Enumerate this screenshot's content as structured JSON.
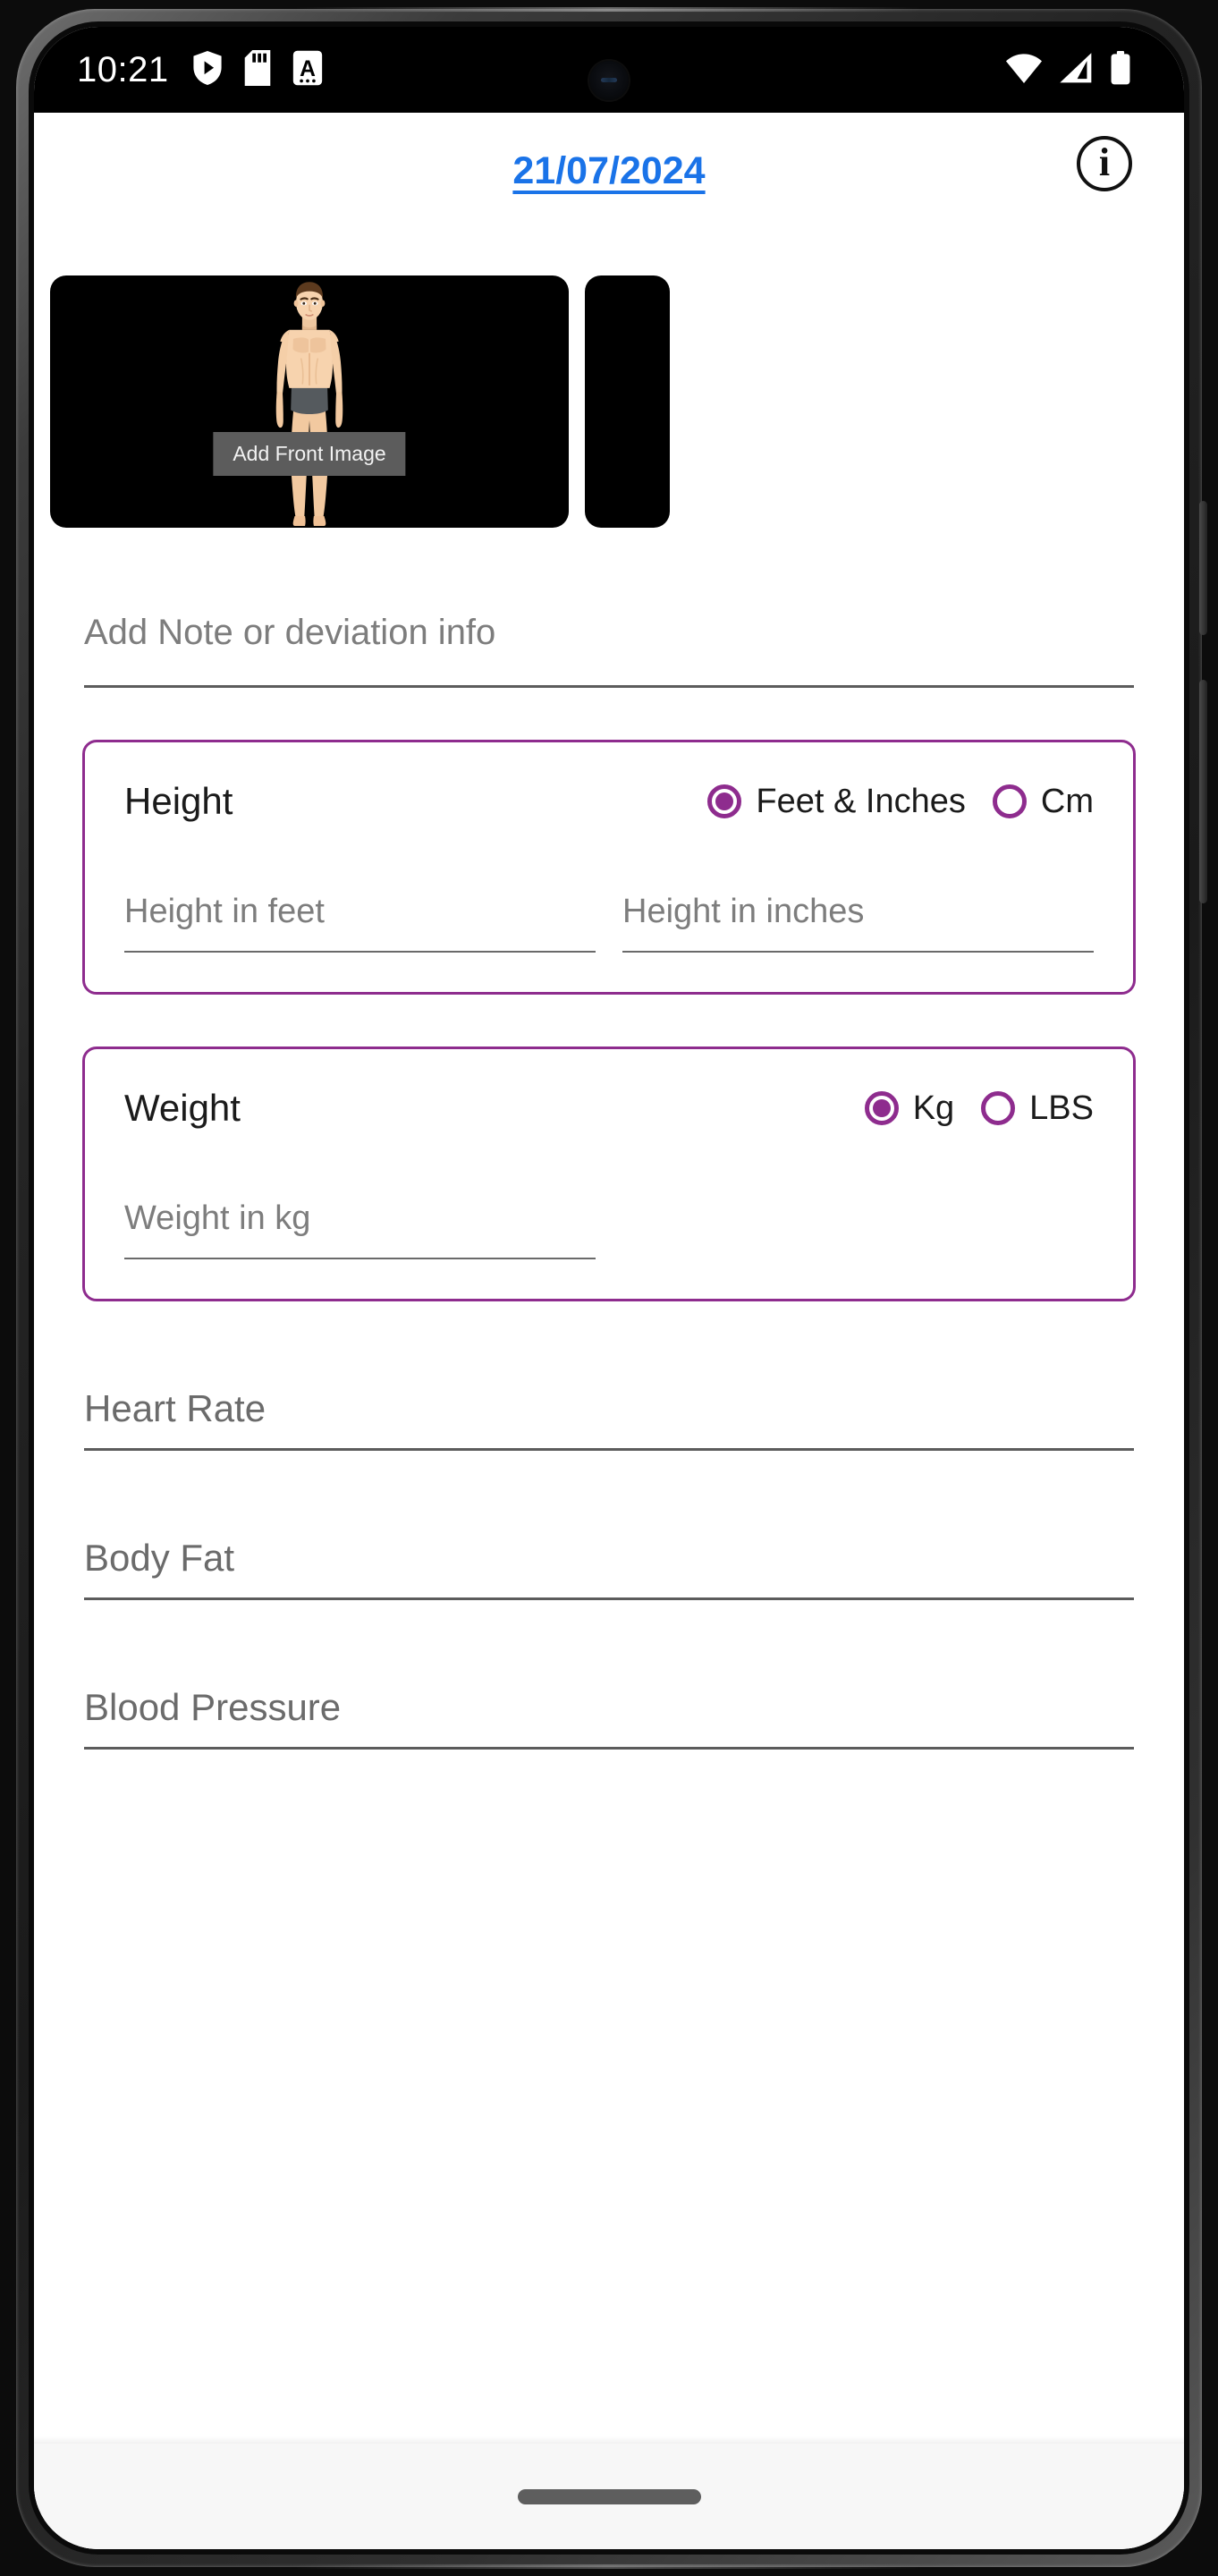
{
  "status_bar": {
    "time": "10:21",
    "left_icons": [
      "shield-play-icon",
      "sd-card-icon",
      "a-badge-icon"
    ],
    "right_icons": [
      "wifi-icon",
      "cellular-signal-icon",
      "battery-full-icon"
    ]
  },
  "header": {
    "date": "21/07/2024",
    "info_glyph": "i"
  },
  "carousel": {
    "cards": [
      {
        "label": "Add Front Image",
        "has_figure": true
      },
      {
        "label": "",
        "has_figure": false
      }
    ]
  },
  "note": {
    "placeholder": "Add Note or deviation info",
    "value": ""
  },
  "height_card": {
    "title": "Height",
    "units": [
      {
        "label": "Feet & Inches",
        "selected": true
      },
      {
        "label": "Cm",
        "selected": false
      }
    ],
    "inputs": [
      {
        "placeholder": "Height in feet",
        "value": ""
      },
      {
        "placeholder": "Height in inches",
        "value": ""
      }
    ]
  },
  "weight_card": {
    "title": "Weight",
    "units": [
      {
        "label": "Kg",
        "selected": true
      },
      {
        "label": "LBS",
        "selected": false
      }
    ],
    "inputs": [
      {
        "placeholder": "Weight in kg",
        "value": ""
      }
    ]
  },
  "vitals": [
    {
      "placeholder": "Heart Rate",
      "value": ""
    },
    {
      "placeholder": "Body Fat",
      "value": ""
    },
    {
      "placeholder": "Blood Pressure",
      "value": ""
    }
  ],
  "colors": {
    "accent_purple": "#8e2c8e",
    "link_blue": "#1a73e8",
    "placeholder_gray": "#7d7d7d",
    "card_black": "#000000",
    "overlay_gray": "#5c5c5c"
  },
  "nav": {
    "pill": "home-indicator"
  }
}
